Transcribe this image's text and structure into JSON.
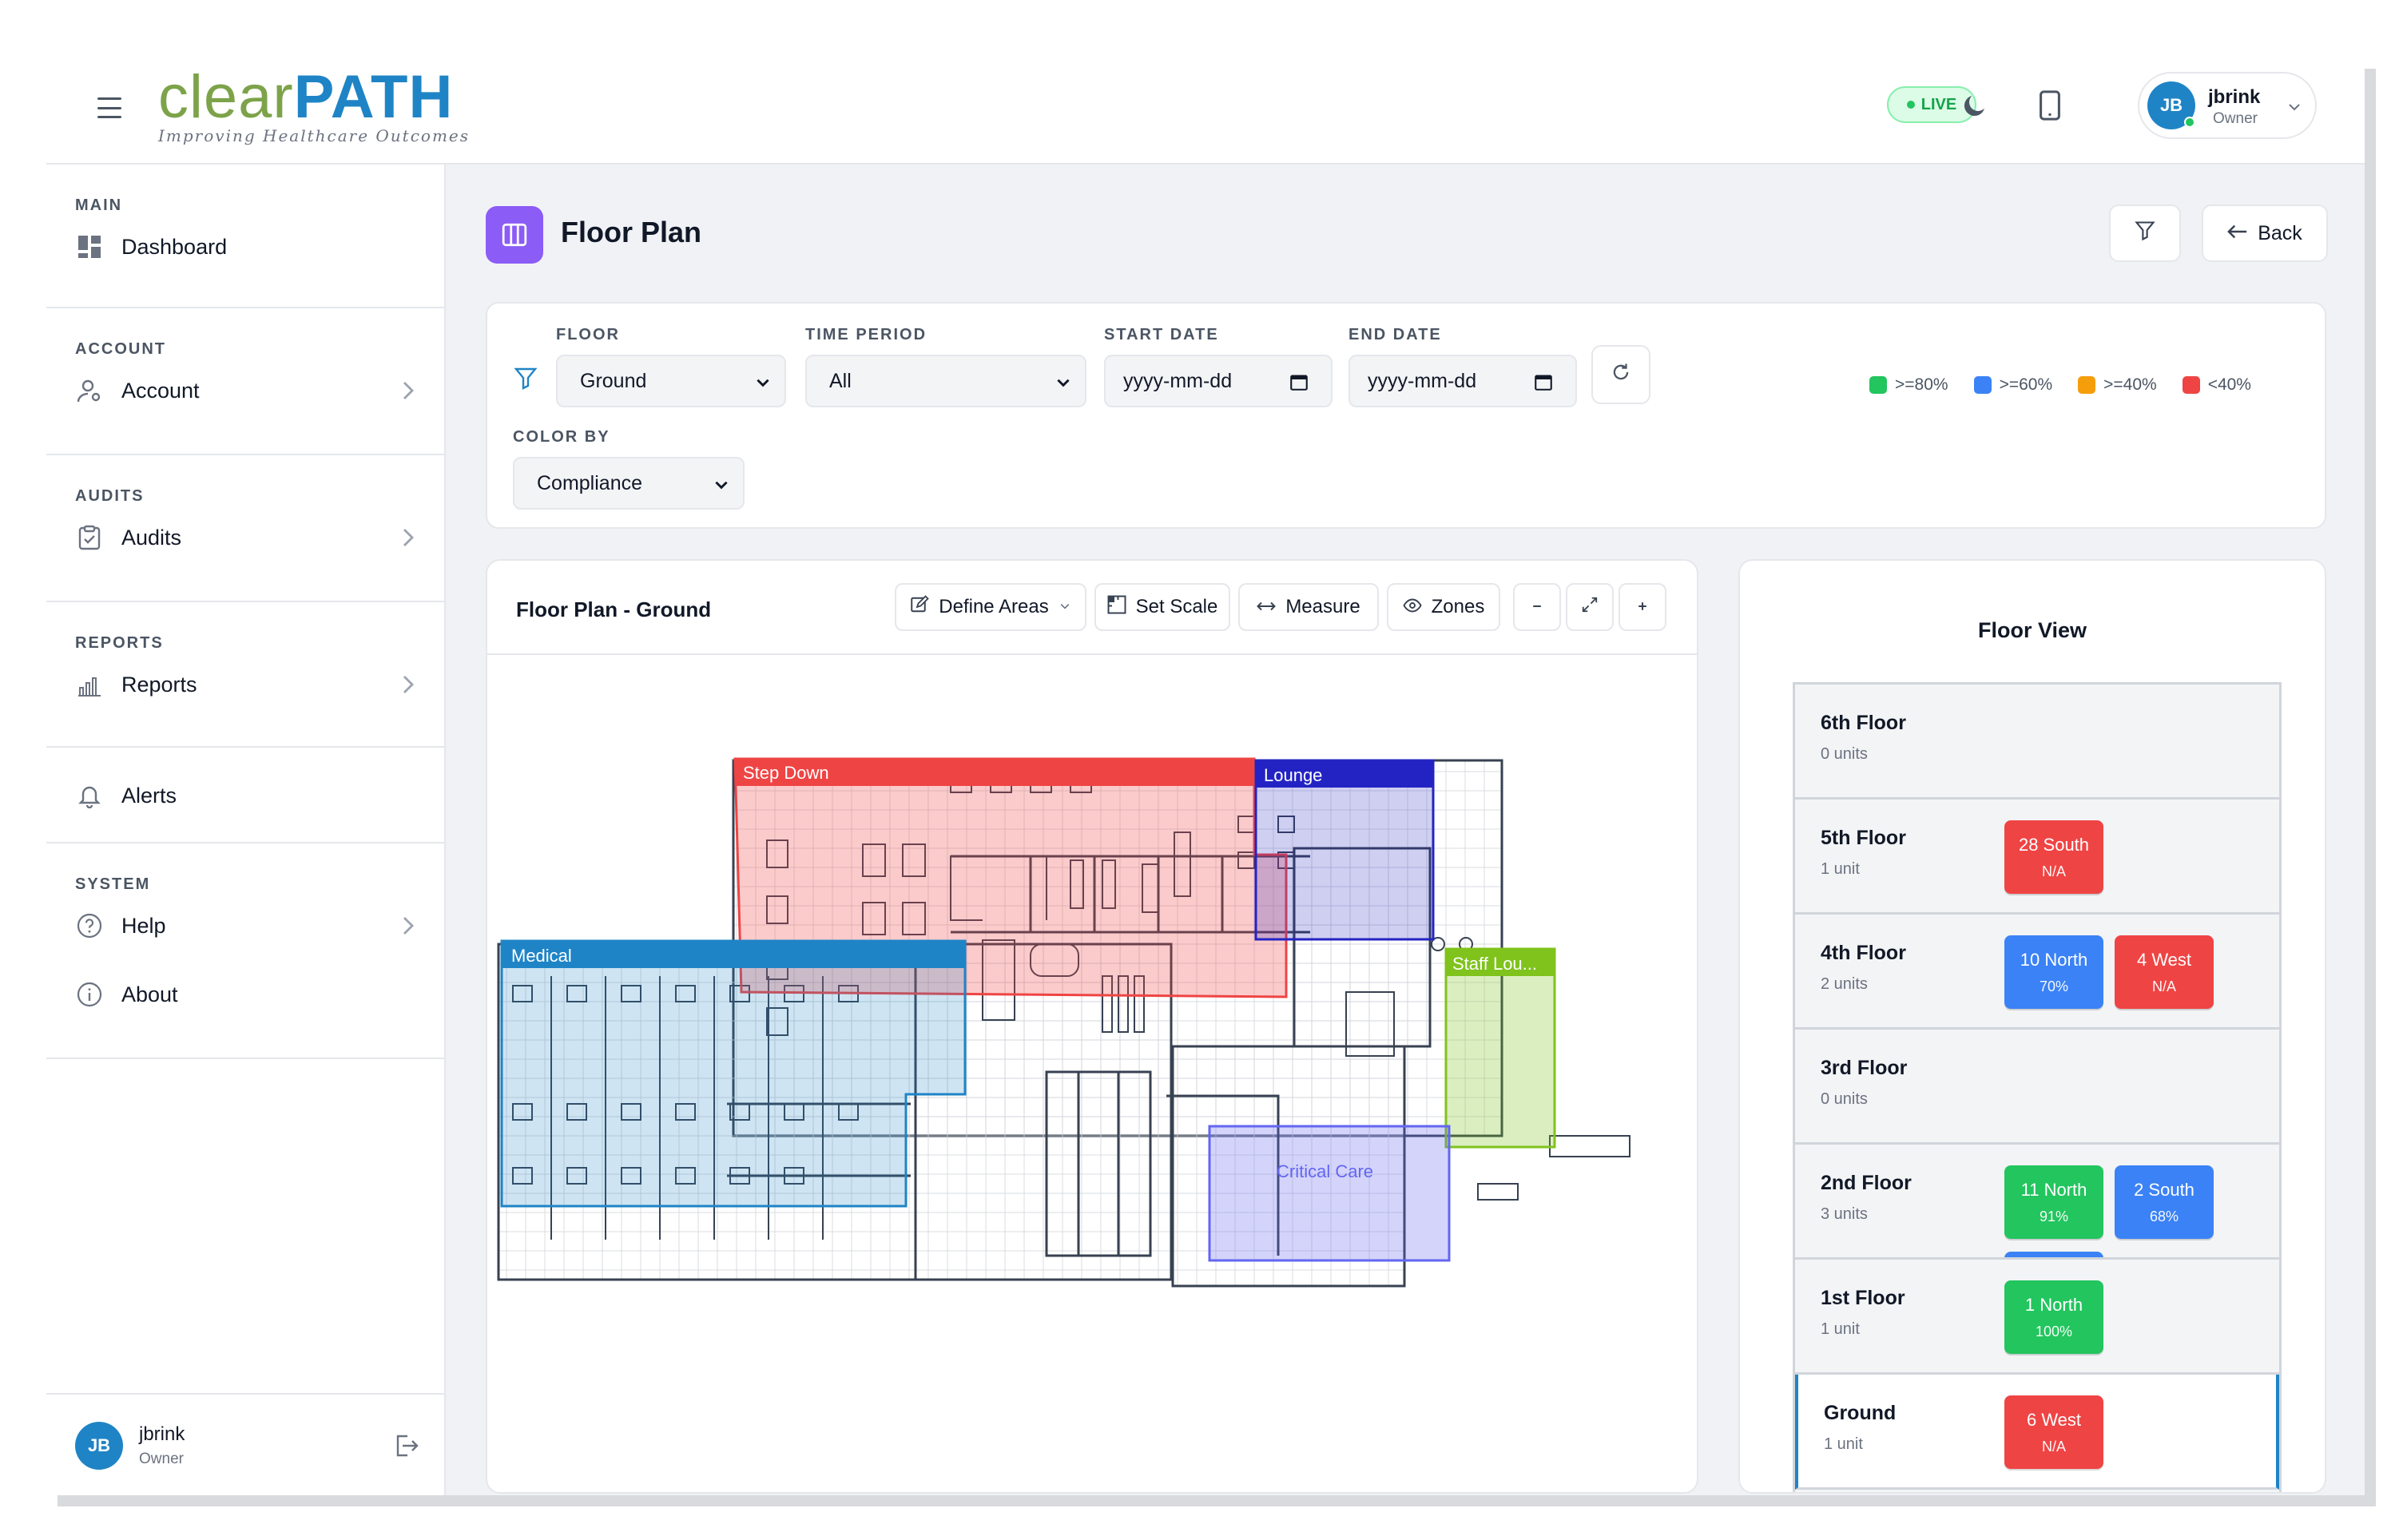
{
  "header": {
    "logo_part1": "clear",
    "logo_part2": "PATH",
    "tagline": "Improving Healthcare Outcomes",
    "live_label": "LIVE",
    "user": {
      "initials": "JB",
      "name": "jbrink",
      "role": "Owner"
    }
  },
  "sidebar": {
    "sections": [
      {
        "title": "MAIN",
        "items": [
          {
            "label": "Dashboard",
            "icon": "dashboard-icon"
          }
        ]
      },
      {
        "title": "ACCOUNT",
        "items": [
          {
            "label": "Account",
            "icon": "account-icon"
          }
        ]
      },
      {
        "title": "AUDITS",
        "items": [
          {
            "label": "Audits",
            "icon": "clipboard-icon"
          }
        ]
      },
      {
        "title": "REPORTS",
        "items": [
          {
            "label": "Reports",
            "icon": "bar-chart-icon"
          }
        ]
      },
      {
        "title": "",
        "items": [
          {
            "label": "Alerts",
            "icon": "bell-icon"
          }
        ]
      },
      {
        "title": "SYSTEM",
        "items": [
          {
            "label": "Help",
            "icon": "help-icon"
          },
          {
            "label": "About",
            "icon": "info-icon"
          }
        ]
      }
    ],
    "footer": {
      "initials": "JB",
      "name": "jbrink",
      "role": "Owner"
    }
  },
  "page": {
    "title": "Floor Plan",
    "back_label": "Back"
  },
  "filters": {
    "floor_label": "FLOOR",
    "floor_value": "Ground",
    "time_label": "TIME PERIOD",
    "time_value": "All",
    "start_label": "START DATE",
    "start_placeholder": "yyyy-mm-dd",
    "end_label": "END DATE",
    "end_placeholder": "yyyy-mm-dd",
    "color_label": "COLOR BY",
    "color_value": "Compliance",
    "legend": [
      {
        "label": ">=80%",
        "color": "#22c55e"
      },
      {
        "label": ">=60%",
        "color": "#3b82f6"
      },
      {
        "label": ">=40%",
        "color": "#f59e0b"
      },
      {
        "label": "<40%",
        "color": "#ef4444"
      }
    ]
  },
  "plan": {
    "title": "Floor Plan - Ground",
    "toolbar": {
      "define_areas": "Define Areas",
      "set_scale": "Set Scale",
      "measure": "Measure",
      "zones": "Zones"
    },
    "zones": [
      {
        "label": "Step Down",
        "color": "#ef4444"
      },
      {
        "label": "Lounge",
        "color": "#2323c4"
      },
      {
        "label": "Staff Lou...",
        "color": "#7fc31c"
      },
      {
        "label": "Medical",
        "color": "#1f84c6"
      },
      {
        "label": "Critical Care",
        "color": "#6366f1"
      }
    ]
  },
  "floor_view": {
    "title": "Floor View",
    "floors": [
      {
        "name": "6th Floor",
        "units_text": "0 units",
        "units": []
      },
      {
        "name": "5th Floor",
        "units_text": "1 unit",
        "units": [
          {
            "name": "28 South",
            "pct": "N/A",
            "color": "#ef4444"
          }
        ]
      },
      {
        "name": "4th Floor",
        "units_text": "2 units",
        "units": [
          {
            "name": "10 North",
            "pct": "70%",
            "color": "#3b82f6"
          },
          {
            "name": "4 West",
            "pct": "N/A",
            "color": "#ef4444"
          }
        ]
      },
      {
        "name": "3rd Floor",
        "units_text": "0 units",
        "units": []
      },
      {
        "name": "2nd Floor",
        "units_text": "3 units",
        "units": [
          {
            "name": "11 North",
            "pct": "91%",
            "color": "#22c55e"
          },
          {
            "name": "2 South",
            "pct": "68%",
            "color": "#3b82f6"
          }
        ]
      },
      {
        "name": "1st Floor",
        "units_text": "1 unit",
        "units": [
          {
            "name": "1 North",
            "pct": "100%",
            "color": "#22c55e"
          }
        ]
      },
      {
        "name": "Ground",
        "units_text": "1 unit",
        "units": [
          {
            "name": "6 West",
            "pct": "N/A",
            "color": "#ef4444"
          }
        ]
      }
    ]
  }
}
